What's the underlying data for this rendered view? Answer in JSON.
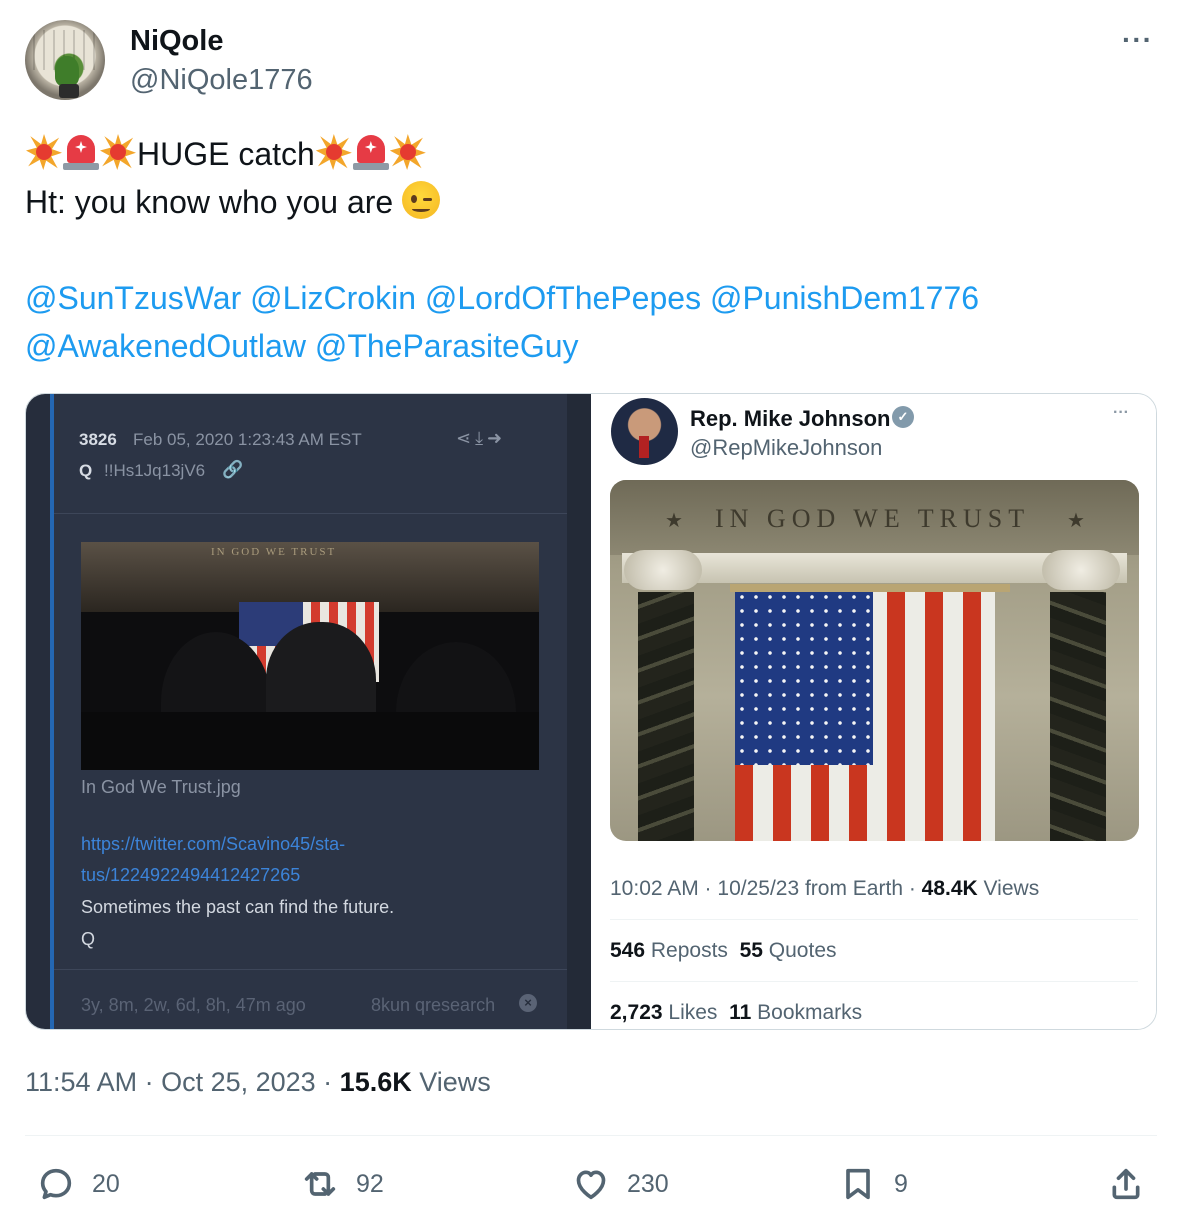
{
  "author": {
    "display_name": "NiQole",
    "handle": "@NiQole1776"
  },
  "more_label": "···",
  "tweet": {
    "line1_text": "HUGE catch",
    "line2_text": "Ht: you know who you are ",
    "mentions_line1": [
      "@SunTzusWar",
      "@LizCrokin",
      "@LordOfThePepes",
      "@PunishDem1776"
    ],
    "mentions_line2": [
      "@AwakenedOutlaw",
      "@TheParasiteGuy"
    ]
  },
  "qpost": {
    "number": "3826",
    "date": "Feb 05, 2020 1:23:43 AM EST",
    "name": "Q",
    "trip": "!!Hs1Jq13jV6",
    "image_inscription": "IN GOD WE TRUST",
    "filename": "In God We Trust.jpg",
    "url_line1": "https://twitter.com/Scavino45/sta-",
    "url_line2": "tus/1224922494412427265",
    "message": "Sometimes the past can find the future.",
    "signature": "Q",
    "age": "3y, 8m, 2w, 6d, 8h, 47m ago",
    "source": "8kun qresearch"
  },
  "embedded_tweet": {
    "name": "Rep. Mike Johnson",
    "handle": "@RepMikeJohnson",
    "image_inscription": "IN GOD WE TRUST",
    "time": "10:02 AM · 10/25/23 from Earth · ",
    "views_count": "48.4K",
    "views_label": " Views",
    "reposts_count": "546",
    "reposts_label": " Reposts",
    "quotes_count": "55",
    "quotes_label": " Quotes",
    "likes_count": "2,723",
    "likes_label": " Likes",
    "bookmarks_count": "11",
    "bookmarks_label": " Bookmarks"
  },
  "timestamp": {
    "time_date": "11:54 AM · Oct 25, 2023 · ",
    "views_count": "15.6K",
    "views_label": " Views"
  },
  "actions": {
    "replies": "20",
    "reposts": "92",
    "likes": "230",
    "bookmarks": "9"
  },
  "icons": [
    "reply-icon",
    "repost-icon",
    "like-icon",
    "bookmark-icon",
    "share-icon",
    "verified-icon",
    "link-icon"
  ],
  "colors": {
    "link": "#1d9bf0",
    "secondary_text": "#536471",
    "qpanel_bg": "#2c3445"
  }
}
